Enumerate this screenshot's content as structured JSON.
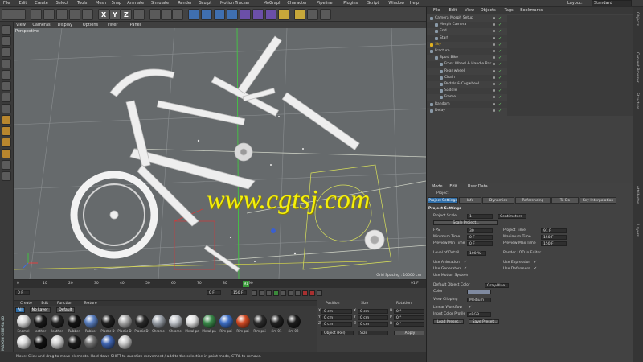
{
  "menubar": {
    "items": [
      "File",
      "Edit",
      "Create",
      "Select",
      "Tools",
      "Mesh",
      "Snap",
      "Animate",
      "Simulate",
      "Render",
      "Sculpt",
      "Motion Tracker",
      "MoGraph",
      "Character",
      "Pipeline",
      "Plugins",
      "Script",
      "Window",
      "Help"
    ],
    "layout_label": "Layout:",
    "layout_value": "Standard"
  },
  "toolbar": {
    "axis_x": "X",
    "axis_y": "Y",
    "axis_z": "Z"
  },
  "viewport": {
    "menu": [
      "View",
      "Cameras",
      "Display",
      "Options",
      "Filter",
      "Panel"
    ],
    "label": "Perspective",
    "grid_spacing": "Grid Spacing : 10000 cm"
  },
  "watermark": "www.cgtsj.com",
  "timeline": {
    "ticks": [
      "0",
      "10",
      "20",
      "30",
      "40",
      "50",
      "60",
      "70",
      "80",
      "90"
    ],
    "frame_current": "0 F",
    "frame_start": "0 F",
    "frame_end": "150 F",
    "frame_end2": "150 F",
    "frame_right": "91 F",
    "marker": "91"
  },
  "materials": {
    "menu": [
      "Create",
      "Edit",
      "Function",
      "Texture"
    ],
    "filters": [
      "All",
      "No Layer",
      "Default"
    ],
    "items": [
      {
        "label": "Enamel",
        "color": "#d8d8d8"
      },
      {
        "label": "leather",
        "color": "#1a1a1a"
      },
      {
        "label": "leather",
        "color": "#222"
      },
      {
        "label": "Rubber",
        "color": "#141414"
      },
      {
        "label": "Rubber",
        "color": "#5a7fc0"
      },
      {
        "label": "Plastic D",
        "color": "#202020"
      },
      {
        "label": "Plastic D",
        "color": "#a8a8a8"
      },
      {
        "label": "Plastic D",
        "color": "#2a2a2a"
      },
      {
        "label": "Chrome",
        "color": "#9aa0a8"
      },
      {
        "label": "Chrome",
        "color": "#c0c4ca"
      },
      {
        "label": "Metal pa",
        "color": "#e0e0e0"
      },
      {
        "label": "Metal pa",
        "color": "#3a8a4a"
      },
      {
        "label": "Rim pai",
        "color": "#3e6fc6"
      },
      {
        "label": "Rim pai",
        "color": "#d24a24"
      },
      {
        "label": "Rim pai",
        "color": "#2b2b2b"
      },
      {
        "label": "rim 01",
        "color": "#202020"
      },
      {
        "label": "rim 02",
        "color": "#1c1c1c"
      }
    ],
    "row2": [
      "#dcdcdc",
      "#111",
      "#cfcfcf",
      "#1b1b1b",
      "#6f6f6f",
      "#3f64b0",
      "#c9c9c9"
    ]
  },
  "coords": {
    "headers": [
      "Position",
      "Size",
      "Rotation"
    ],
    "rows": [
      {
        "axis": "X",
        "pos": "0 cm",
        "size": "0 cm",
        "rot_axis": "H",
        "rot": "0 °"
      },
      {
        "axis": "Y",
        "pos": "0 cm",
        "size": "0 cm",
        "rot_axis": "P",
        "rot": "0 °"
      },
      {
        "axis": "Z",
        "pos": "0 cm",
        "size": "0 cm",
        "rot_axis": "B",
        "rot": "0 °"
      }
    ],
    "mode": "Object (Rel)",
    "size_mode": "Size",
    "apply": "Apply"
  },
  "status": "Move: Click and drag to move elements. Hold down SHIFT to quantize movement / add to the selection in point mode, CTRL to remove.",
  "logo": "MAXON CINEMA 4D",
  "objects": {
    "menu": [
      "File",
      "Edit",
      "View",
      "Objects",
      "Tags",
      "Bookmarks"
    ],
    "rows": [
      {
        "name": "Camera Morph Setup",
        "indent": 0
      },
      {
        "name": "Morph Camera",
        "indent": 1
      },
      {
        "name": "End",
        "indent": 1
      },
      {
        "name": "Start",
        "indent": 1
      },
      {
        "name": "Sky",
        "indent": 0,
        "accent": "#e0b020"
      },
      {
        "name": "Fracture",
        "indent": 0
      },
      {
        "name": "Sport Bike",
        "indent": 1
      },
      {
        "name": "Front Wheel & Handle Bar",
        "indent": 2
      },
      {
        "name": "Rear wheel",
        "indent": 2
      },
      {
        "name": "Chain",
        "indent": 2
      },
      {
        "name": "Pedals & Cogwheel",
        "indent": 2
      },
      {
        "name": "Saddle",
        "indent": 2
      },
      {
        "name": "Frame",
        "indent": 2
      },
      {
        "name": "Random",
        "indent": 0
      },
      {
        "name": "Delay",
        "indent": 0
      }
    ]
  },
  "attributes": {
    "header": [
      "Mode",
      "Edit",
      "User Data"
    ],
    "project_label": "Project",
    "tabs": [
      "Project Settings",
      "Info",
      "Dynamics",
      "Referencing",
      "To Do",
      "Key Interpolation"
    ],
    "section": "Project Settings",
    "project_scale_label": "Project Scale",
    "project_scale_value": "1",
    "project_scale_unit": "Centimeters",
    "scale_project_btn": "Scale Project...",
    "fps_label": "FPS",
    "fps_value": "30",
    "project_time_label": "Project Time",
    "project_time_value": "91 F",
    "min_time_label": "Minimum Time",
    "min_time_value": "0 F",
    "max_time_label": "Maximum Time",
    "max_time_value": "150 F",
    "prev_min_label": "Preview Min Time",
    "prev_min_value": "0 F",
    "prev_max_label": "Preview Max Time",
    "prev_max_value": "150 F",
    "lod_label": "Level of Detail",
    "lod_value": "100 %",
    "render_lod_label": "Render LOD in Editor",
    "use_animation": "Use Animation",
    "use_expression": "Use Expression",
    "use_generators": "Use Generators",
    "use_deformers": "Use Deformers",
    "use_motion": "Use Motion System",
    "default_color_label": "Default Object Color",
    "default_color_value": "Gray-Blue",
    "color_label": "Color",
    "view_clipping_label": "View Clipping",
    "view_clipping_value": "Medium",
    "linear_workflow": "Linear Workflow",
    "input_color_label": "Input Color Profile",
    "input_color_value": "sRGB",
    "load_preset": "Load Preset...",
    "save_preset": "Save Preset..."
  },
  "right_strip": [
    "Objects",
    "Content Browser",
    "Structure",
    "Attributes",
    "Layers"
  ]
}
